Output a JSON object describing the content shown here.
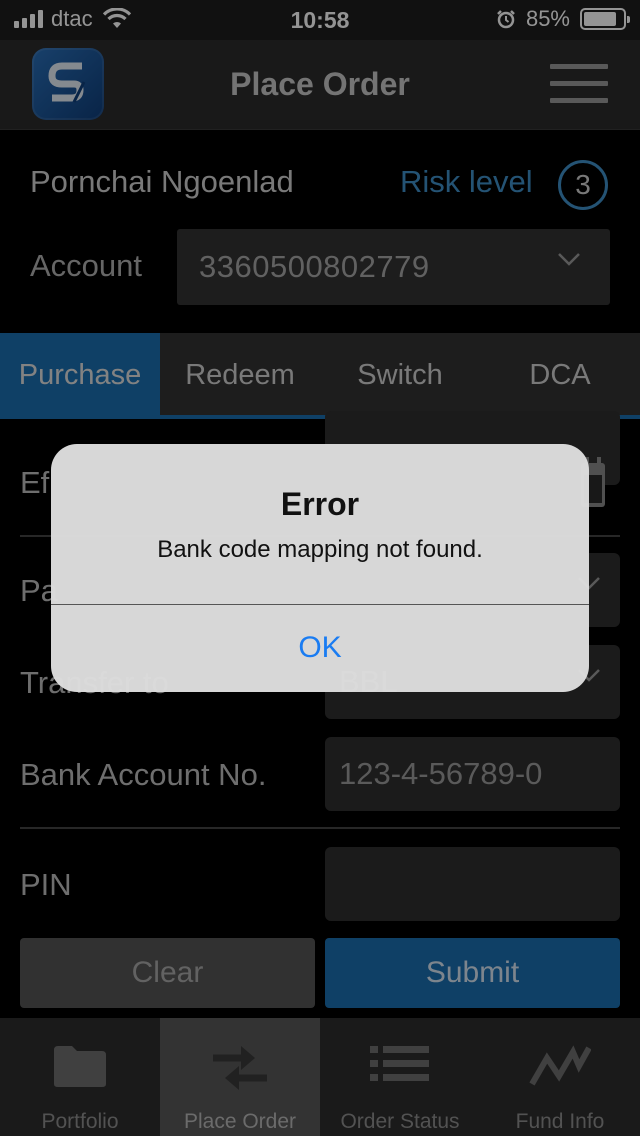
{
  "status_bar": {
    "carrier": "dtac",
    "time": "10:58",
    "battery_percent": "85%",
    "battery_level": 0.85
  },
  "header": {
    "title": "Place Order",
    "logo_icon": "app-logo-icon",
    "menu_icon": "hamburger-menu-icon"
  },
  "user": {
    "name": "Pornchai Ngoenlad",
    "risk_label": "Risk level",
    "risk_value": "3",
    "account_label": "Account",
    "account_number": "3360500802779"
  },
  "tabs": [
    {
      "label": "Purchase",
      "active": true
    },
    {
      "label": "Redeem",
      "active": false
    },
    {
      "label": "Switch",
      "active": false
    },
    {
      "label": "DCA",
      "active": false
    }
  ],
  "form": {
    "effective_label_partial": "Ef",
    "pay_label_partial": "Pa",
    "transfer_label_partial": "Transfer to",
    "transfer_value_partial": "BBL",
    "bank_account_label": "Bank Account No.",
    "bank_account_placeholder": "123-4-56789-0",
    "pin_label": "PIN",
    "clear_label": "Clear",
    "submit_label": "Submit"
  },
  "alert": {
    "title": "Error",
    "message": "Bank code mapping not found.",
    "ok_label": "OK"
  },
  "bottom_nav": [
    {
      "label": "Portfolio",
      "icon": "folder-icon",
      "active": false
    },
    {
      "label": "Place Order",
      "icon": "swap-arrows-icon",
      "active": true
    },
    {
      "label": "Order Status",
      "icon": "list-icon",
      "active": false
    },
    {
      "label": "Fund Info",
      "icon": "line-chart-icon",
      "active": false
    }
  ],
  "colors": {
    "accent": "#1a6fb0",
    "risk": "#3f8fc9",
    "alert_button": "#1a7cf2"
  }
}
